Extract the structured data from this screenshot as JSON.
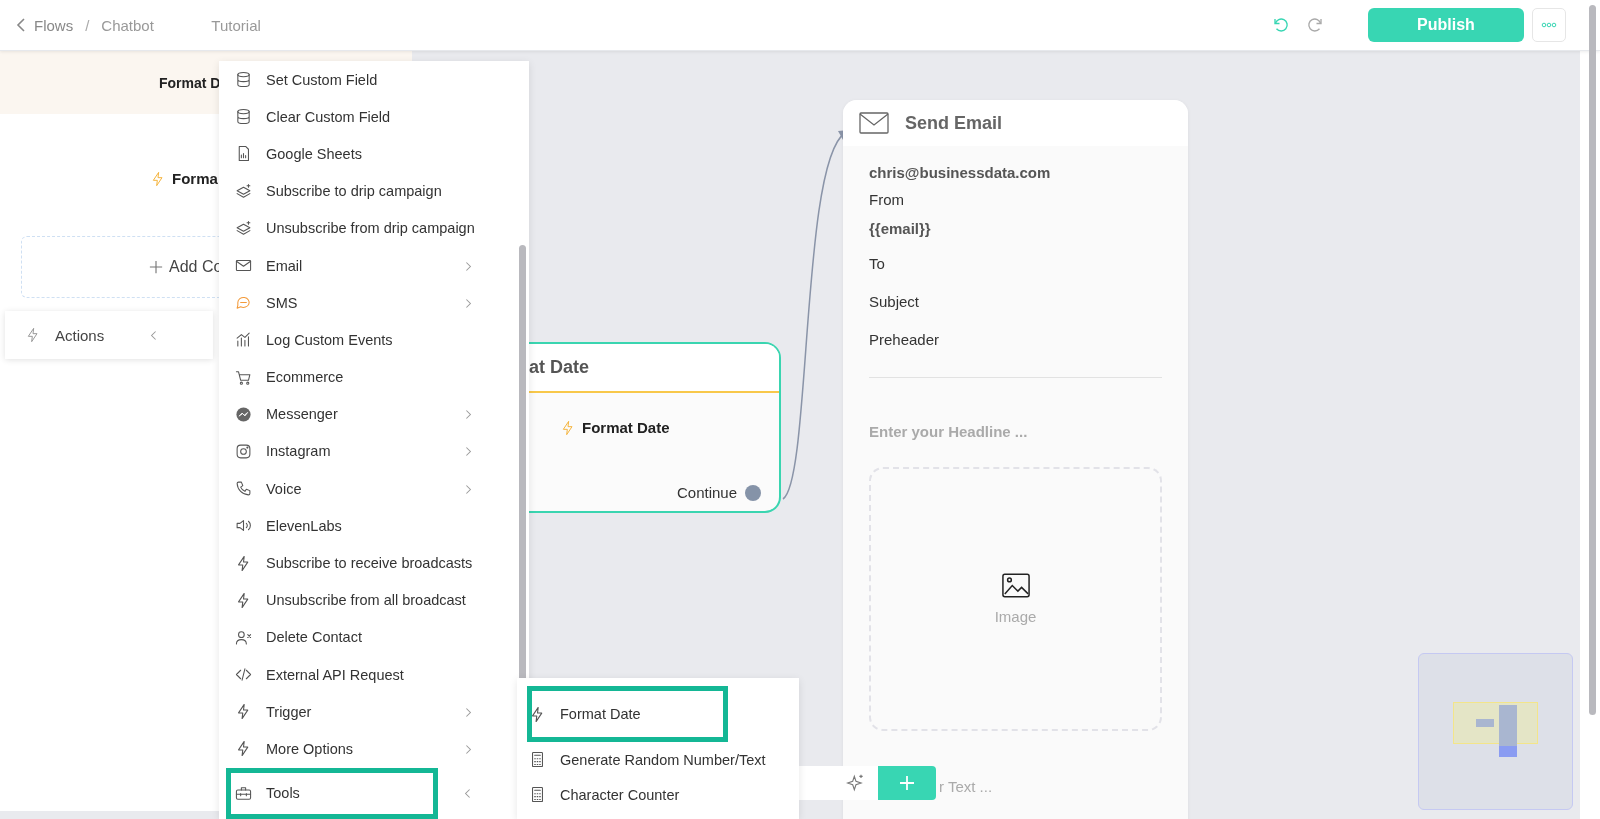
{
  "header": {
    "back_link": "Flows",
    "separator": "/",
    "breadcrumb": [
      "Chatbot",
      "Tutorial"
    ],
    "publish": "Publish"
  },
  "left_panel": {
    "step_title": "Format D",
    "action_label": "Forma",
    "add_content": "Add Co",
    "sidebar_tab": "Actions"
  },
  "menu": [
    {
      "label": "Set Custom Field",
      "has_submenu": false,
      "expanded": false
    },
    {
      "label": "Clear Custom Field",
      "has_submenu": false,
      "expanded": false
    },
    {
      "label": "Google Sheets",
      "has_submenu": false,
      "expanded": false
    },
    {
      "label": "Subscribe to drip campaign",
      "has_submenu": false,
      "expanded": false
    },
    {
      "label": "Unsubscribe from drip campaign",
      "has_submenu": false,
      "expanded": false
    },
    {
      "label": "Email",
      "has_submenu": true,
      "expanded": false
    },
    {
      "label": "SMS",
      "has_submenu": true,
      "expanded": false
    },
    {
      "label": "Log Custom Events",
      "has_submenu": false,
      "expanded": false
    },
    {
      "label": "Ecommerce",
      "has_submenu": false,
      "expanded": false
    },
    {
      "label": "Messenger",
      "has_submenu": true,
      "expanded": false
    },
    {
      "label": "Instagram",
      "has_submenu": true,
      "expanded": false
    },
    {
      "label": "Voice",
      "has_submenu": true,
      "expanded": false
    },
    {
      "label": "ElevenLabs",
      "has_submenu": false,
      "expanded": false
    },
    {
      "label": "Subscribe to receive broadcasts",
      "has_submenu": false,
      "expanded": false
    },
    {
      "label": "Unsubscribe from all broadcast",
      "has_submenu": false,
      "expanded": false
    },
    {
      "label": "Delete Contact",
      "has_submenu": false,
      "expanded": false
    },
    {
      "label": "External API Request",
      "has_submenu": false,
      "expanded": false
    },
    {
      "label": "Trigger",
      "has_submenu": true,
      "expanded": false
    },
    {
      "label": "More Options",
      "has_submenu": true,
      "expanded": false
    },
    {
      "label": "Tools",
      "has_submenu": true,
      "expanded": true
    }
  ],
  "submenu": [
    {
      "label": "Format Date",
      "selected": true
    },
    {
      "label": "Generate Random Number/Text",
      "selected": false
    },
    {
      "label": "Character Counter",
      "selected": false
    }
  ],
  "node": {
    "title": "at Date",
    "action": "Format Date",
    "output": "Continue"
  },
  "email_card": {
    "title": "Send Email",
    "lines": [
      {
        "text": "chris@businessdata.com",
        "kind": "value"
      },
      {
        "text": "From",
        "kind": "label"
      },
      {
        "text": "{{email}}",
        "kind": "value"
      },
      {
        "text": "To",
        "kind": "label"
      },
      {
        "text": "Subject",
        "kind": "label"
      },
      {
        "text": "Preheader",
        "kind": "label"
      }
    ],
    "headline_placeholder": "Enter your Headline ...",
    "image_label": "Image",
    "text_placeholder": "r Text ..."
  }
}
